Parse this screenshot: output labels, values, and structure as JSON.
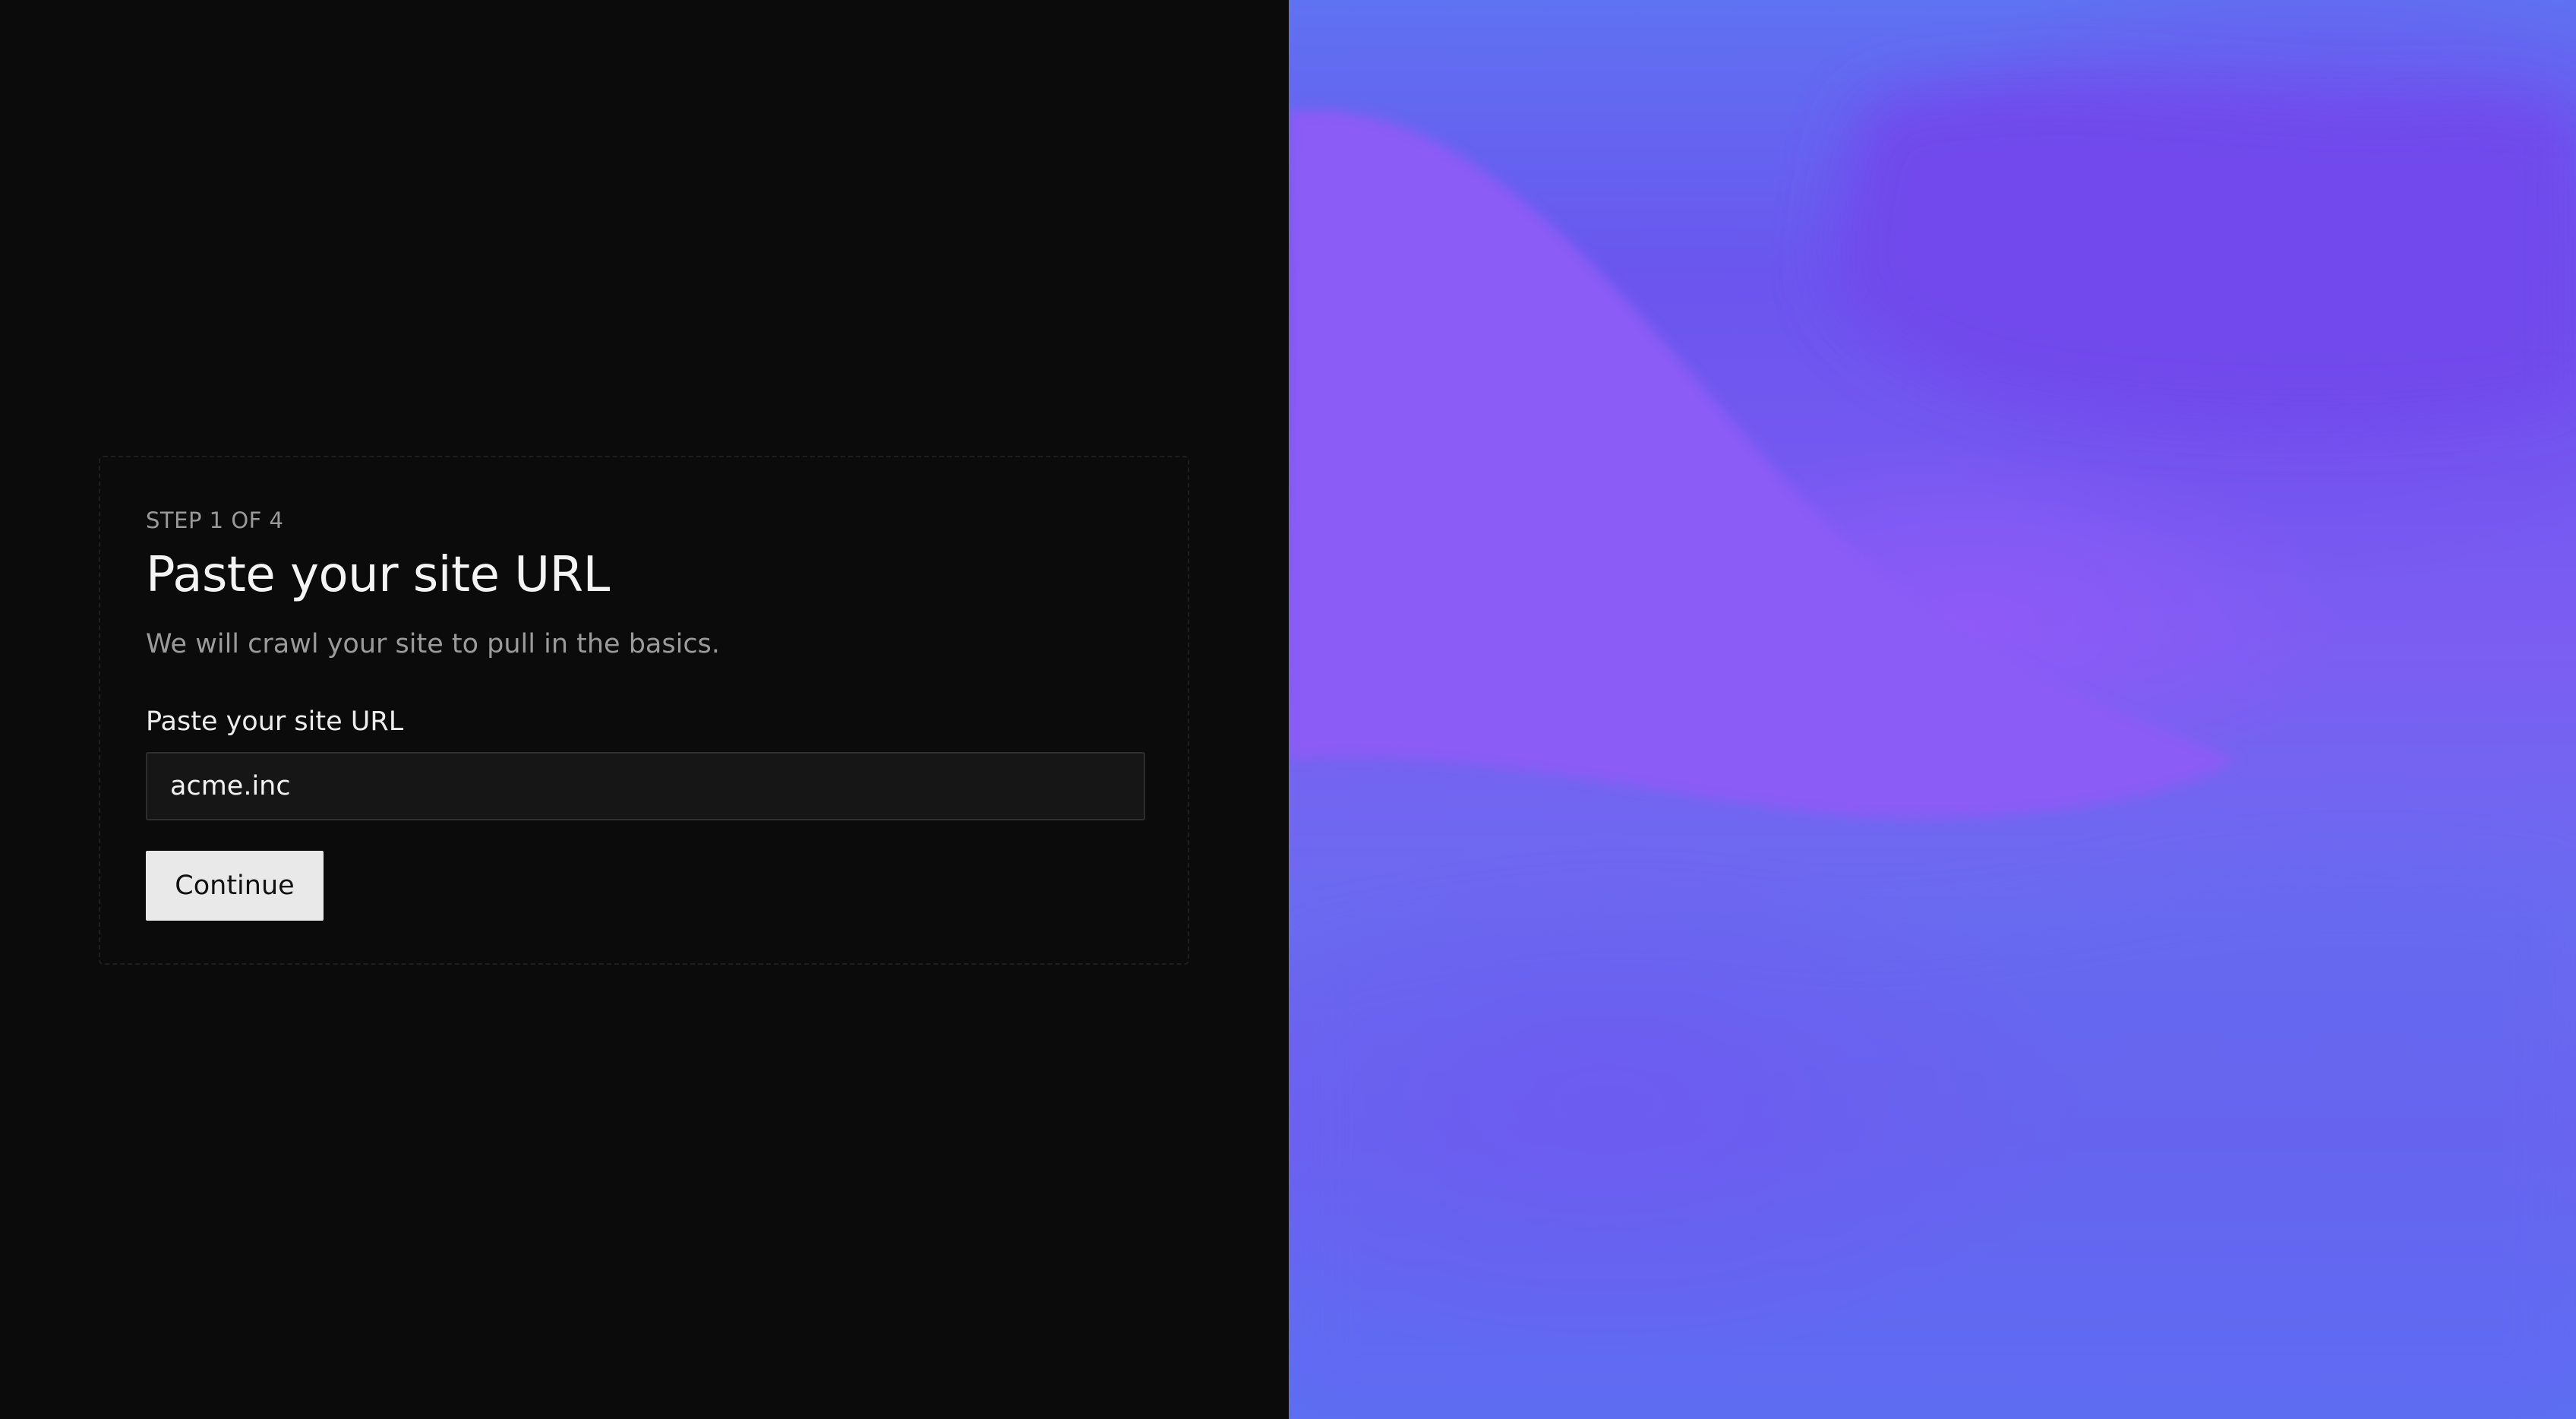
{
  "onboarding": {
    "step_text": "STEP 1 OF 4",
    "title": "Paste your site URL",
    "subtitle": "We will crawl your site to pull in the basics.",
    "field_label": "Paste your site URL",
    "url_value": "acme.inc",
    "continue_label": "Continue"
  },
  "colors": {
    "background": "#0b0b0b",
    "input_background": "#161616",
    "button_background": "#e9e9e9",
    "art_purple": "#8b5cf6",
    "art_blue": "#5b70f3"
  }
}
